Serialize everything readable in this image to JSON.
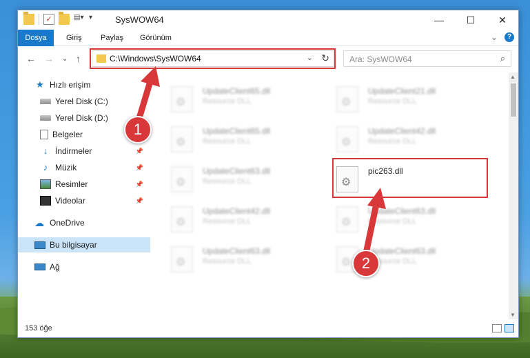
{
  "window": {
    "title": "SysWOW64",
    "controls": {
      "minimize": "—",
      "maximize": "☐",
      "close": "✕"
    }
  },
  "ribbon": {
    "tabs": [
      "Dosya",
      "Giriş",
      "Paylaş",
      "Görünüm"
    ],
    "help": "?",
    "expand": "⌄"
  },
  "address": {
    "path": "C:\\Windows\\SysWOW64",
    "search_placeholder": "Ara: SysWOW64"
  },
  "sidebar": {
    "quick_access": "Hızlı erişim",
    "items": [
      {
        "label": "Yerel Disk (C:)",
        "icon": "disk-icon",
        "pinned": false
      },
      {
        "label": "Yerel Disk (D:)",
        "icon": "disk-icon",
        "pinned": false
      },
      {
        "label": "Belgeler",
        "icon": "documents-icon",
        "pinned": true
      },
      {
        "label": "İndirmeler",
        "icon": "downloads-icon",
        "pinned": true
      },
      {
        "label": "Müzik",
        "icon": "music-icon",
        "pinned": true
      },
      {
        "label": "Resimler",
        "icon": "pictures-icon",
        "pinned": true
      },
      {
        "label": "Videolar",
        "icon": "videos-icon",
        "pinned": true
      }
    ],
    "onedrive": "OneDrive",
    "this_pc": "Bu bilgisayar",
    "network": "Ağ"
  },
  "files": {
    "left_column": [
      {
        "name": "UpdateClient65.dll",
        "desc": "Resource DLL"
      },
      {
        "name": "UpdateClient65.dll",
        "desc": "Resource DLL"
      },
      {
        "name": "UpdateClient63.dll",
        "desc": "Resource DLL"
      },
      {
        "name": "UpdateClient42.dll",
        "desc": "Resource DLL"
      },
      {
        "name": "UpdateClient63.dll",
        "desc": "Resource DLL"
      }
    ],
    "right_column": [
      {
        "name": "UpdateClient21.dll",
        "desc": "Resource DLL"
      },
      {
        "name": "UpdateClient42.dll",
        "desc": "Resource DLL"
      },
      {
        "name": "UpdateClient63.dll",
        "desc": "Resource DLL"
      },
      {
        "name": "UpdateClient63.dll",
        "desc": "Resource DLL"
      }
    ],
    "highlighted": {
      "name": "pic263.dll"
    }
  },
  "status": {
    "count": "153 öğe"
  },
  "annotations": {
    "badge1": "1",
    "badge2": "2",
    "color": "#d9383a"
  }
}
